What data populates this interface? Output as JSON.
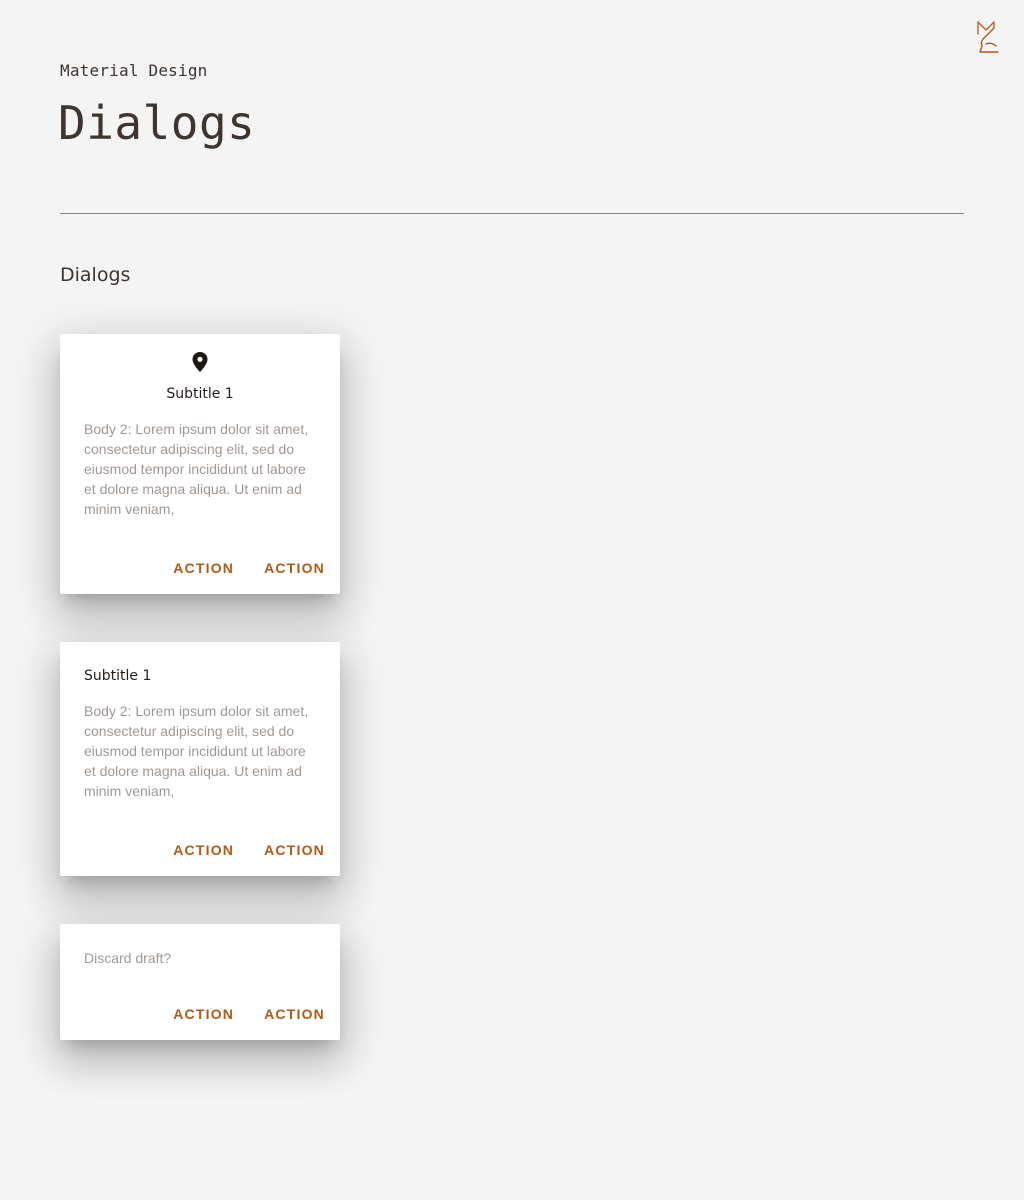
{
  "header": {
    "eyebrow": "Material Design",
    "title": "Dialogs"
  },
  "logo": {
    "icon": "brand-logo-icon",
    "color": "#c0622a"
  },
  "section": {
    "title": "Dialogs"
  },
  "dialogs": [
    {
      "icon": "location-pin-icon",
      "subtitle": "Subtitle 1",
      "body": "Body 2: Lorem ipsum dolor sit amet, consectetur adipiscing elit, sed do eiusmod tempor incididunt ut labore et dolore magna aliqua. Ut enim ad minim veniam,",
      "actions": [
        "ACTION",
        "ACTION"
      ]
    },
    {
      "subtitle": "Subtitle 1",
      "body": "Body 2: Lorem ipsum dolor sit amet, consectetur adipiscing elit, sed do eiusmod tempor incididunt ut labore et dolore magna aliqua. Ut enim ad minim veniam,",
      "actions": [
        "ACTION",
        "ACTION"
      ]
    },
    {
      "body": "Discard draft?",
      "actions": [
        "ACTION",
        "ACTION"
      ]
    }
  ],
  "colors": {
    "background": "#f4f4f4",
    "accent": "#b05a16",
    "text_primary": "#3e3430",
    "text_secondary": "#a09894"
  }
}
